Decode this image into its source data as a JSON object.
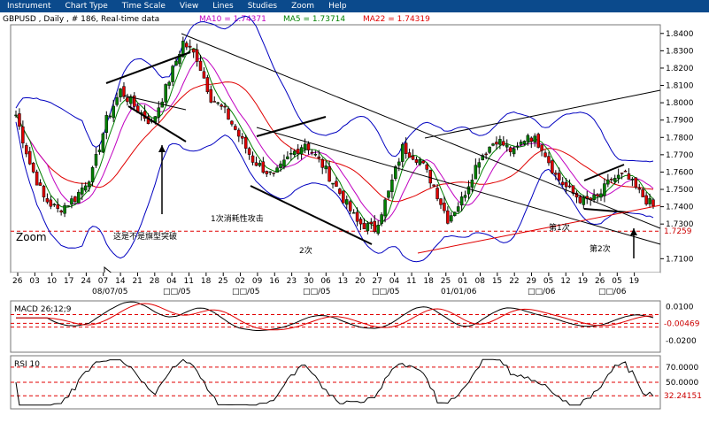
{
  "menu": {
    "items": [
      "Instrument",
      "Chart Type",
      "Time Scale",
      "View",
      "Lines",
      "Studies",
      "Zoom",
      "Help"
    ]
  },
  "header": {
    "symbol_text": "GBPUSD , Daily , # 186, Real-time data",
    "ma10_text": "MA10 = 1.74371",
    "ma5_text": "MA5 = 1.73714",
    "ma22_text": "MA22 = 1.74319"
  },
  "colors": {
    "ma10": "#c000c0",
    "ma5": "#008000",
    "ma22": "#e00000",
    "header_bg": "#0b4a8c",
    "bull": "#008000",
    "bear": "#e00000",
    "band": "#0000c0"
  },
  "chart_data": [
    {
      "type": "candlestick",
      "name": "price",
      "ylim": [
        1.702,
        1.845
      ],
      "y_ticks": [
        "1.8400",
        "1.8300",
        "1.8200",
        "1.8100",
        "1.8000",
        "1.7900",
        "1.7800",
        "1.7700",
        "1.7600",
        "1.7500",
        "1.7400",
        "1.7300",
        "1.7100"
      ],
      "y_tick_values": [
        1.84,
        1.83,
        1.82,
        1.81,
        1.8,
        1.79,
        1.78,
        1.77,
        1.76,
        1.75,
        1.74,
        1.73,
        1.71
      ],
      "hline_value": 1.7259,
      "hline_label": "1.7259",
      "x_ticks": [
        "26",
        "03",
        "10",
        "17",
        "24",
        "07",
        "14",
        "21",
        "28",
        "04",
        "11",
        "18",
        "25",
        "02",
        "09",
        "16",
        "23",
        "30",
        "06",
        "13",
        "20",
        "27",
        "04",
        "11",
        "18",
        "25",
        "01",
        "08",
        "15",
        "22",
        "29",
        "05",
        "12",
        "19",
        "26",
        "05",
        "19"
      ],
      "x_periods": [
        "08/07/05",
        "□□/05",
        "□□/05",
        "□□/05",
        "□□/05",
        "01/01/06",
        "□□/06",
        "□□/06"
      ],
      "annotations": [
        "Zoom",
        "这是不是旗型突破",
        "1次消耗性攻击",
        "2次",
        "第1次",
        "第2次"
      ]
    },
    {
      "type": "line",
      "name": "MACD",
      "title": "MACD 26;12;9",
      "ylim": [
        -0.03,
        0.015
      ],
      "y_ticks": [
        "0.0100",
        "-0.0200"
      ],
      "y_tick_values": [
        0.01,
        -0.02
      ],
      "value_label": "-0.00469",
      "value": -0.00469
    },
    {
      "type": "line",
      "name": "RSI",
      "title": "RSI 10",
      "ylim": [
        15,
        85
      ],
      "y_ticks": [
        "70.0000",
        "50.0000"
      ],
      "y_tick_values": [
        70,
        50
      ],
      "value_label": "32.24151",
      "value": 32.24151
    }
  ]
}
